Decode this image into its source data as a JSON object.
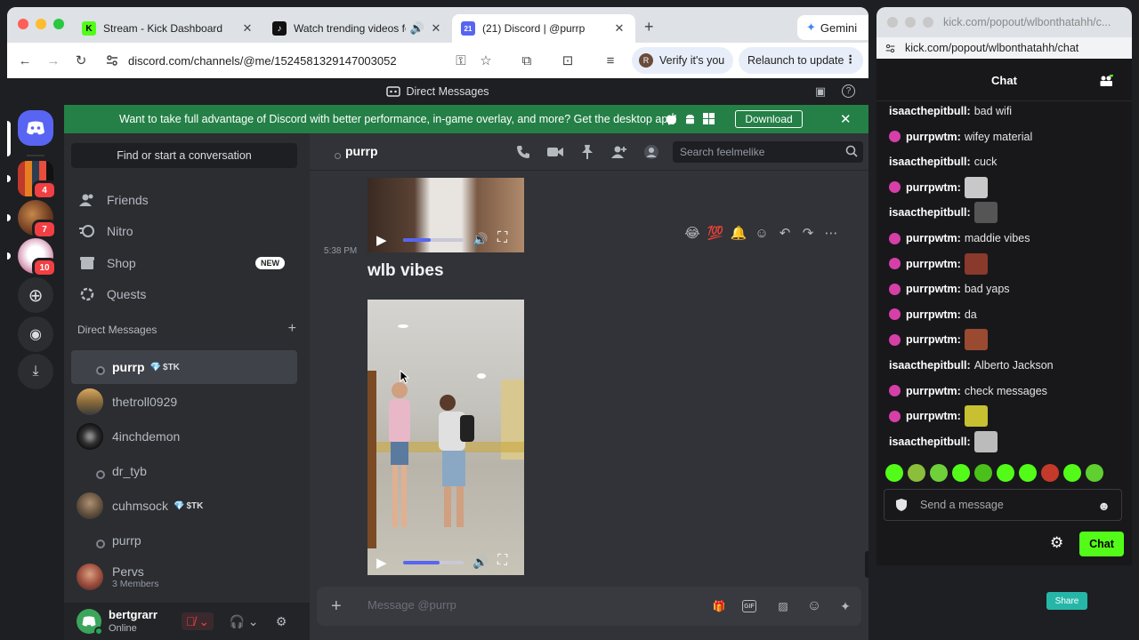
{
  "browser": {
    "tabs": [
      {
        "title": "Stream - Kick Dashboard",
        "favicon": "kick-icon"
      },
      {
        "title": "Watch trending videos for",
        "favicon": "tiktok-icon"
      },
      {
        "title": "(21) Discord | @purrp",
        "favicon": "discord-icon"
      }
    ],
    "gemini_label": "Gemini",
    "url": "discord.com/channels/@me/1524581329147003052",
    "verify_label": "Verify it's you",
    "verify_avatar_letter": "R",
    "relaunch_label": "Relaunch to update"
  },
  "discord": {
    "top_title": "Direct Messages",
    "banner": {
      "text": "Want to take full advantage of Discord with better performance, in-game overlay, and more? Get the desktop app!",
      "download_label": "Download"
    },
    "server_badges": [
      "4",
      "7",
      "10"
    ],
    "sidebar": {
      "find_label": "Find or start a conversation",
      "nav": [
        {
          "label": "Friends",
          "icon": "friends-icon"
        },
        {
          "label": "Nitro",
          "icon": "nitro-icon"
        },
        {
          "label": "Shop",
          "icon": "shop-icon",
          "badge": "NEW"
        },
        {
          "label": "Quests",
          "icon": "quests-icon"
        }
      ],
      "dm_header": "Direct Messages",
      "dms": [
        {
          "name": "purrp",
          "tag": "$TK"
        },
        {
          "name": "thetroll0929"
        },
        {
          "name": "4inchdemon"
        },
        {
          "name": "dr_tyb"
        },
        {
          "name": "cuhmsock",
          "tag": "$TK"
        },
        {
          "name": "purrp"
        },
        {
          "name": "Pervs",
          "sub": "3 Members"
        }
      ]
    },
    "user": {
      "name": "bertgrarr",
      "status": "Online"
    },
    "chat": {
      "channel_name": "purrp",
      "search_placeholder": "Search feelmelike",
      "message_time": "5:38 PM",
      "message_text": "wlb vibes",
      "video1_progress": 0.45,
      "video2_progress": 0.6,
      "reactions": [
        "😂",
        "💯",
        "🔔"
      ],
      "composer_placeholder": "Message @purrp"
    }
  },
  "kick": {
    "window_url_title": "kick.com/popout/wlbonthatahh/c...",
    "url": "kick.com/popout/wlbonthatahh/chat",
    "header": "Chat",
    "messages": [
      {
        "user": "isaacthepitbull:",
        "text": "bad wifi",
        "badge": false
      },
      {
        "user": "purrpwtm:",
        "text": "wifey material",
        "badge": true
      },
      {
        "user": "isaacthepitbull:",
        "text": "cuck",
        "badge": false
      },
      {
        "user": "purrpwtm:",
        "text": "",
        "badge": true,
        "emote": "#c8c8c8"
      },
      {
        "user": "isaacthepitbull:",
        "text": "",
        "badge": false,
        "emote": "#555555"
      },
      {
        "user": "purrpwtm:",
        "text": "maddie vibes",
        "badge": true
      },
      {
        "user": "purrpwtm:",
        "text": "",
        "badge": true,
        "emote": "#8a3a2a"
      },
      {
        "user": "purrpwtm:",
        "text": "bad yaps",
        "badge": true
      },
      {
        "user": "purrpwtm:",
        "text": "da",
        "badge": true
      },
      {
        "user": "purrpwtm:",
        "text": "",
        "badge": true,
        "emote": "#9a4a30"
      },
      {
        "user": "isaacthepitbull:",
        "text": "Alberto Jackson",
        "badge": false
      },
      {
        "user": "purrpwtm:",
        "text": "check messages",
        "badge": true
      },
      {
        "user": "purrpwtm:",
        "text": "",
        "badge": true,
        "emote": "#c8c030"
      },
      {
        "user": "isaacthepitbull:",
        "text": "",
        "badge": false,
        "emote": "#bbbbbb"
      }
    ],
    "input_placeholder": "Send a message",
    "chat_button": "Chat"
  },
  "background": {
    "share_label": "Share"
  },
  "colors": {
    "kick_green": "#53fc18",
    "discord_blurple": "#5865f2",
    "discord_green_banner": "#248046"
  }
}
